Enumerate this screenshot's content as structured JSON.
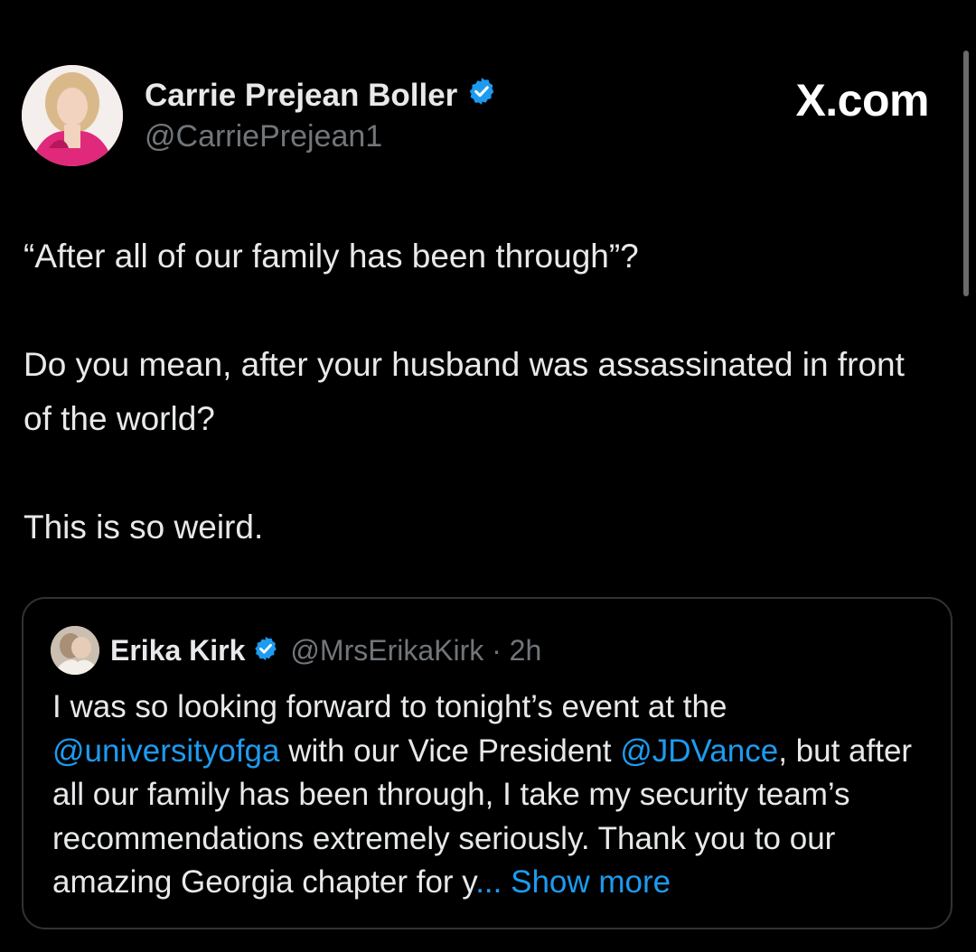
{
  "author": {
    "display_name": "Carrie Prejean Boller",
    "handle": "@CarriePrejean1",
    "verified_icon": "verified-badge-icon"
  },
  "brand": "X.com",
  "tweet": {
    "paragraphs": [
      "“After all of our family has been through”?",
      "Do you mean, after your husband was assassinated in front of the world?",
      "This is so weird."
    ]
  },
  "quoted_tweet": {
    "display_name": "Erika Kirk",
    "handle": "@MrsErikaKirk",
    "separator": " · ",
    "time": "2h",
    "text_part1": "I was so looking forward to tonight’s event at the ",
    "mention1": "@universityofga",
    "text_part2": " with our Vice President ",
    "mention2": "@JDVance",
    "text_part3": ", but after all our family has been through, I take my security team’s recommendations extremely seriously. Thank you to our amazing Georgia chapter for y",
    "ellipsis": "...",
    "show_more": "Show more"
  },
  "colors": {
    "background": "#000000",
    "text": "#e7e9ea",
    "secondary_text": "#71767b",
    "link": "#1d9bf0",
    "border": "#2f3336",
    "verified": "#1d9bf0"
  }
}
